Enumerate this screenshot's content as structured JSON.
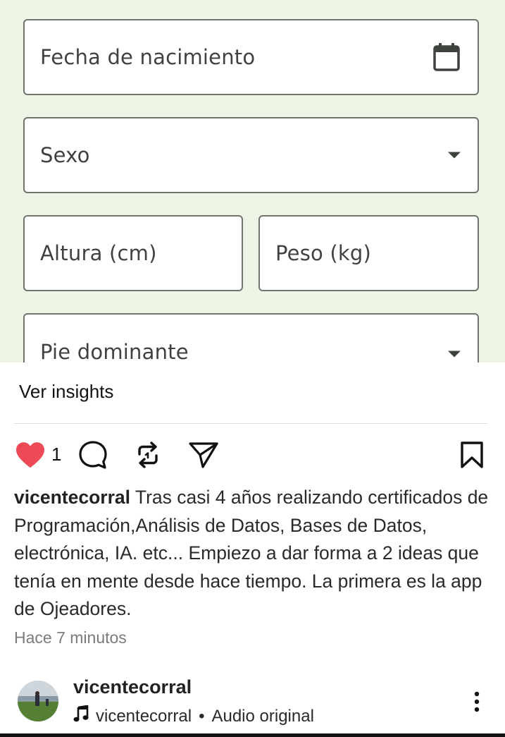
{
  "form": {
    "birthdate_label": "Fecha de nacimiento",
    "sex_label": "Sexo",
    "height_label": "Altura (cm)",
    "weight_label": "Peso (kg)",
    "foot_label": "Pie dominante",
    "icons": {
      "birthdate": "calendar-icon",
      "dropdown": "caret-down-icon"
    }
  },
  "post": {
    "insights_label": "Ver insights",
    "like_count": "1",
    "username": "vicentecorral",
    "caption_text": " Tras casi 4 años realizando certificados de Programación,Análisis de Datos, Bases de Datos, electrónica, IA. etc... Empiezo a dar forma a 2 ideas que tenía en mente desde hace tiempo. La primera es la app de Ojeadores.",
    "timestamp": "Hace 7 minutos",
    "icons": {
      "like": "heart-icon",
      "comment": "comment-bubble-icon",
      "repost": "repost-icon",
      "share": "send-icon",
      "save": "bookmark-icon",
      "more": "more-vertical-icon",
      "audio": "music-note-icon"
    },
    "like_color": "#ed4956"
  },
  "author": {
    "name": "vicentecorral",
    "audio_user": "vicentecorral",
    "audio_separator": "•",
    "audio_label": "Audio original"
  }
}
